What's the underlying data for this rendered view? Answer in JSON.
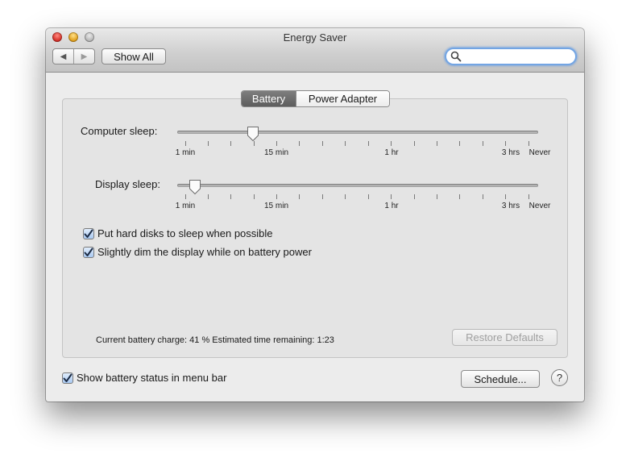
{
  "window": {
    "title": "Energy Saver"
  },
  "toolbar": {
    "back_glyph": "◀",
    "forward_glyph": "▶",
    "show_all_label": "Show All",
    "search_value": "",
    "search_placeholder": ""
  },
  "tabs": [
    {
      "label": "Battery",
      "selected": true
    },
    {
      "label": "Power Adapter",
      "selected": false
    }
  ],
  "computer_sleep": {
    "label": "Computer sleep:",
    "value": "15 min",
    "tick_labels": [
      "1 min",
      "15 min",
      "1 hr",
      "3 hrs",
      "Never"
    ]
  },
  "display_sleep": {
    "label": "Display sleep:",
    "value": "2 min",
    "tick_labels": [
      "1 min",
      "15 min",
      "1 hr",
      "3 hrs",
      "Never"
    ]
  },
  "options": [
    {
      "label": "Put hard disks to sleep when possible",
      "checked": true
    },
    {
      "label": "Slightly dim the display while on battery power",
      "checked": true
    }
  ],
  "status": {
    "text": "Current battery charge: 41 %  Estimated time remaining: 1:23"
  },
  "restore_defaults_label": "Restore Defaults",
  "footer": {
    "show_status_label": "Show battery status in menu bar",
    "show_status_checked": true,
    "schedule_label": "Schedule...",
    "help_label": "?"
  }
}
